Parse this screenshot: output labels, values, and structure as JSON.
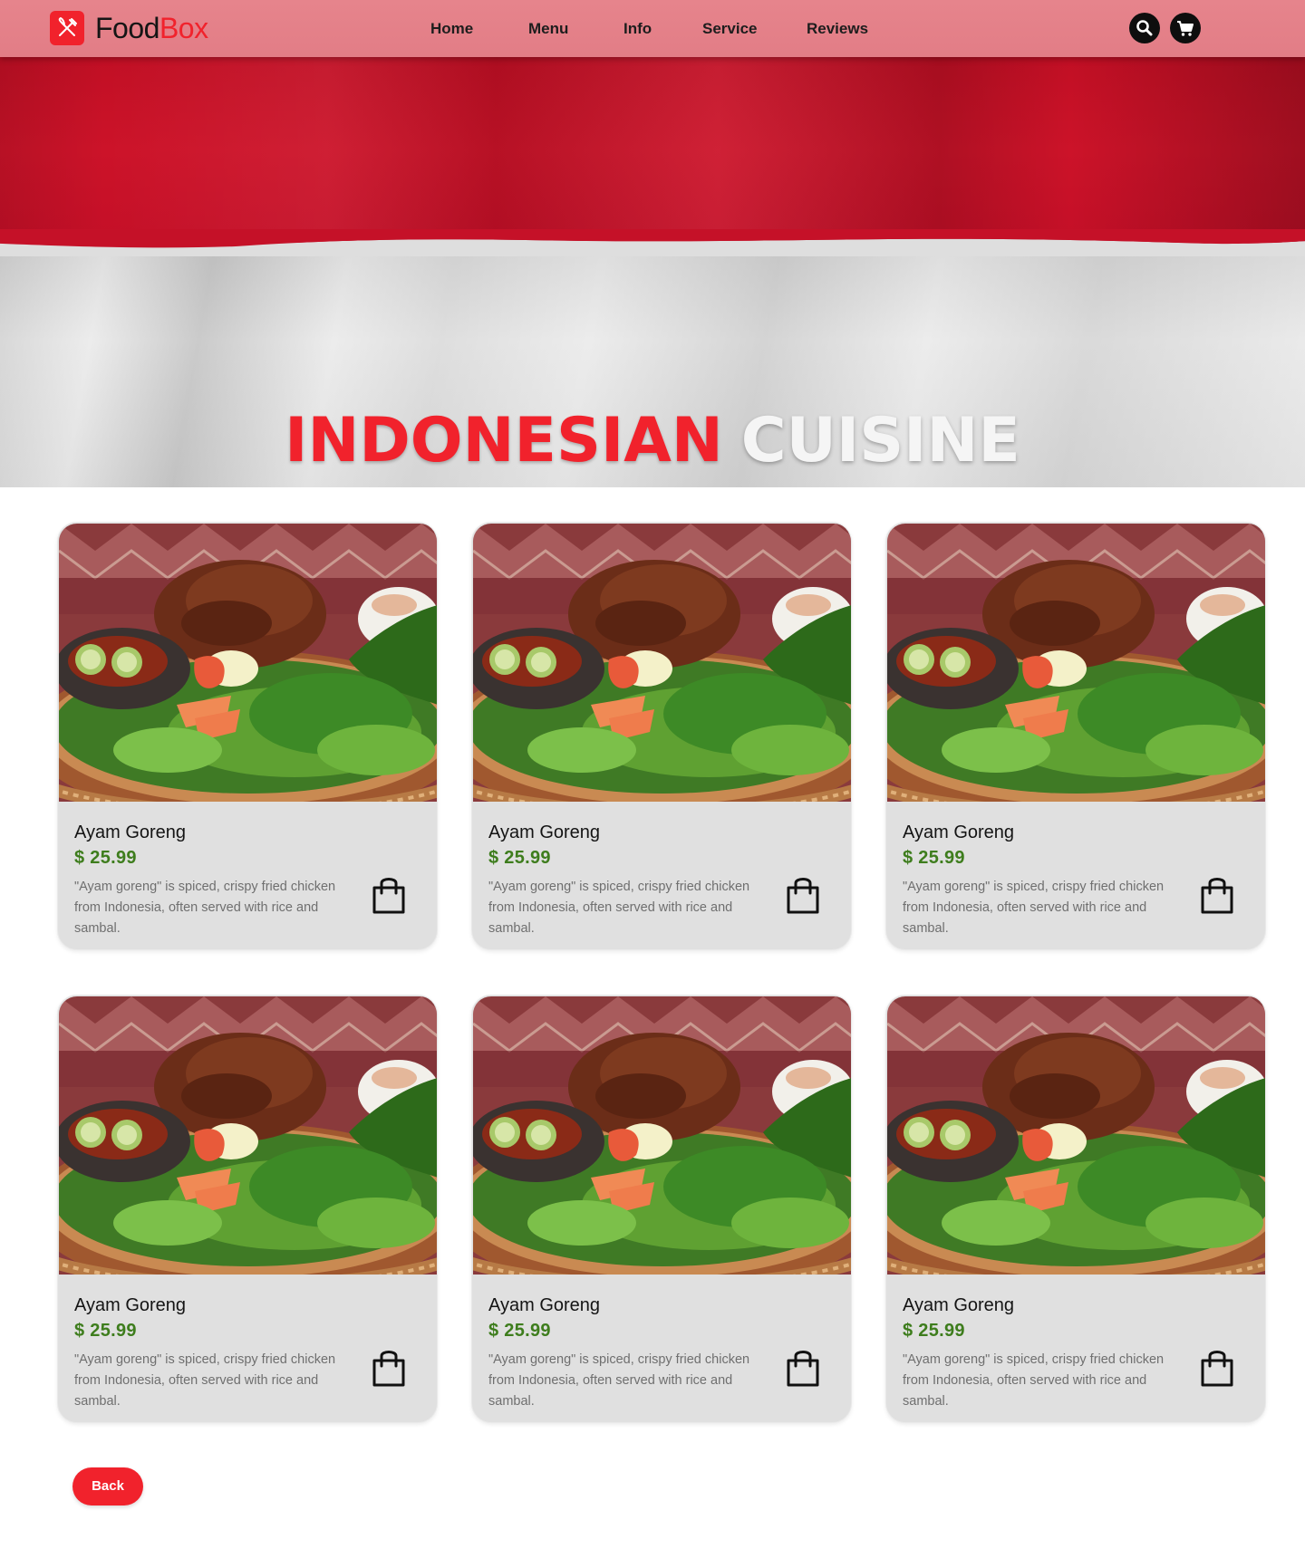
{
  "brand": {
    "name_part1": "Food",
    "name_part2": "Box",
    "accent_color": "#f1222c",
    "icon": "fork-knife-icon"
  },
  "nav": {
    "items": [
      {
        "label": "Home"
      },
      {
        "label": "Menu"
      },
      {
        "label": "Info"
      },
      {
        "label": "Service"
      },
      {
        "label": "Reviews"
      }
    ],
    "actions": [
      {
        "icon": "search-icon"
      },
      {
        "icon": "cart-icon"
      }
    ]
  },
  "hero": {
    "title_part1": "INDONESIAN",
    "title_part2": "CUISINE",
    "background": "indonesian-flag"
  },
  "cards": [
    {
      "name": "Ayam Goreng",
      "price": "$ 25.99",
      "description": "\"Ayam goreng\" is spiced, crispy fried chicken from Indonesia, often served with rice and sambal.",
      "icon": "shopping-bag-icon"
    },
    {
      "name": "Ayam Goreng",
      "price": "$ 25.99",
      "description": "\"Ayam goreng\" is spiced, crispy fried chicken from Indonesia, often served with rice and sambal.",
      "icon": "shopping-bag-icon"
    },
    {
      "name": "Ayam Goreng",
      "price": "$ 25.99",
      "description": "\"Ayam goreng\" is spiced, crispy fried chicken from Indonesia, often served with rice and sambal.",
      "icon": "shopping-bag-icon"
    },
    {
      "name": "Ayam Goreng",
      "price": "$ 25.99",
      "description": "\"Ayam goreng\" is spiced, crispy fried chicken from Indonesia, often served with rice and sambal.",
      "icon": "shopping-bag-icon"
    },
    {
      "name": "Ayam Goreng",
      "price": "$ 25.99",
      "description": "\"Ayam goreng\" is spiced, crispy fried chicken from Indonesia, often served with rice and sambal.",
      "icon": "shopping-bag-icon"
    },
    {
      "name": "Ayam Goreng",
      "price": "$ 25.99",
      "description": "\"Ayam goreng\" is spiced, crispy fried chicken from Indonesia, often served with rice and sambal.",
      "icon": "shopping-bag-icon"
    }
  ],
  "back_button": {
    "label": "Back"
  },
  "colors": {
    "price": "#3e7d1d",
    "navbar": "#e6848c",
    "card_bg": "#e0e0e0"
  }
}
